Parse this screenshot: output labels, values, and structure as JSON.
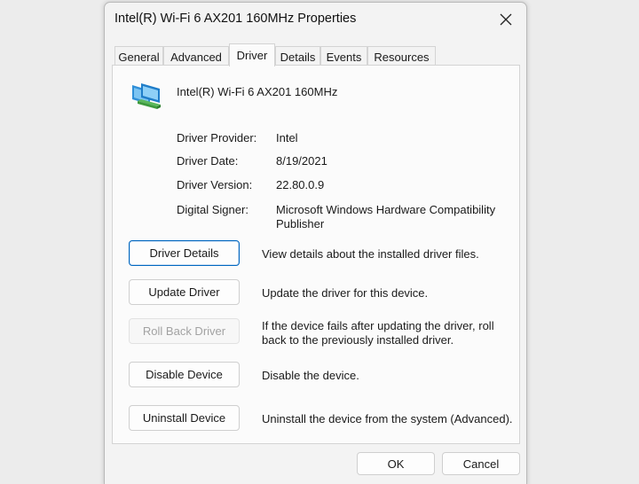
{
  "window": {
    "title": "Intel(R) Wi-Fi 6 AX201 160MHz Properties"
  },
  "tabs": [
    {
      "label": "General"
    },
    {
      "label": "Advanced"
    },
    {
      "label": "Driver",
      "active": true
    },
    {
      "label": "Details"
    },
    {
      "label": "Events"
    },
    {
      "label": "Resources"
    }
  ],
  "device": {
    "name": "Intel(R) Wi-Fi 6 AX201 160MHz",
    "icon": "network-adapter-icon"
  },
  "info": {
    "provider_label": "Driver Provider:",
    "provider_value": "Intel",
    "date_label": "Driver Date:",
    "date_value": "8/19/2021",
    "version_label": "Driver Version:",
    "version_value": "22.80.0.9",
    "signer_label": "Digital Signer:",
    "signer_value": "Microsoft Windows Hardware Compatibility Publisher"
  },
  "actions": {
    "details_label": "Driver Details",
    "details_desc": "View details about the installed driver files.",
    "update_label": "Update Driver",
    "update_desc": "Update the driver for this device.",
    "rollback_label": "Roll Back Driver",
    "rollback_desc": "If the device fails after updating the driver, roll back to the previously installed driver.",
    "disable_label": "Disable Device",
    "disable_desc": "Disable the device.",
    "uninstall_label": "Uninstall Device",
    "uninstall_desc": "Uninstall the device from the system (Advanced)."
  },
  "footer": {
    "ok_label": "OK",
    "cancel_label": "Cancel"
  },
  "colors": {
    "accent": "#0067c0",
    "disabled_text": "#a2a2a2"
  }
}
